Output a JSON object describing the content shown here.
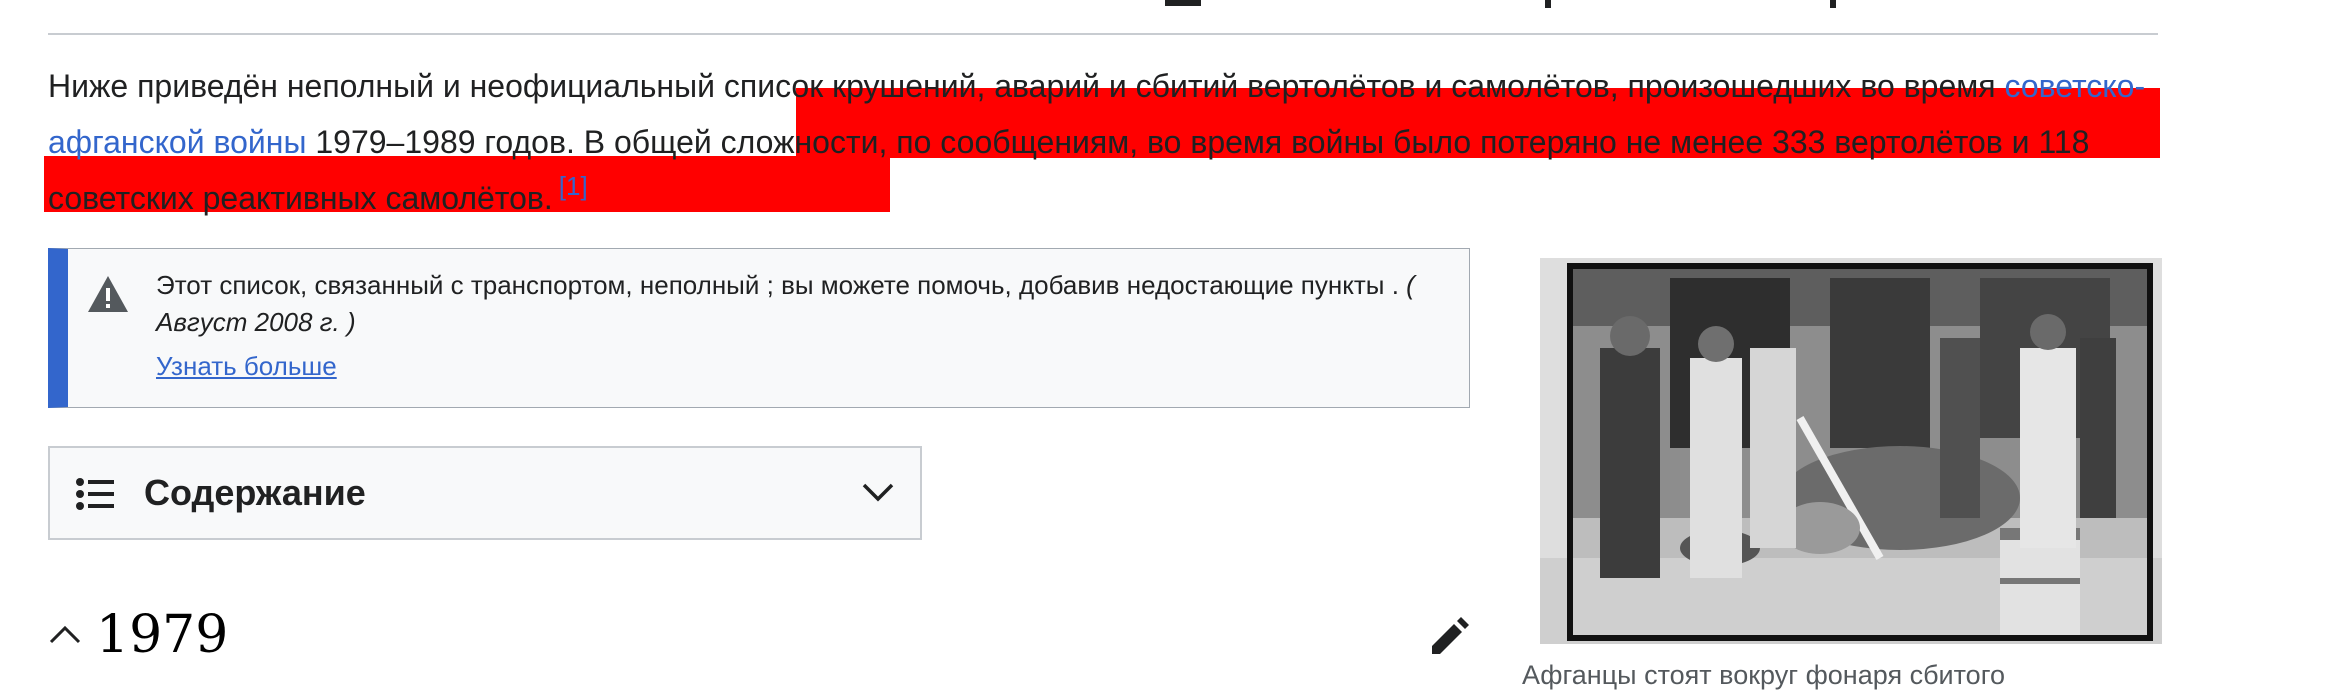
{
  "intro": {
    "text_start": "Ниже приведён неполный и неофициальный список крушений, аварий и сбитий вертолётов и самолётов, произошедших во время ",
    "war_link": "советско-афганской войны",
    "text_mid": " 1979–1989 годов. ",
    "text_highlighted": "В общей сложности, по сообщениям, во время войны было потеряно не менее 333 вертолётов и 118 советских реактивных самолётов.",
    "ref": "[1]",
    "highlight_color": "#ff0000"
  },
  "notice": {
    "icon": "warning-icon",
    "text": "Этот список, связанный с транспортом, неполный ; вы можете помочь, добавив недостающие пункты . ",
    "date": "( Август 2008 г. )",
    "learn_more": "Узнать больше"
  },
  "toc": {
    "icon": "list-icon",
    "title": "Содержание",
    "chevron": "chevron-down-icon"
  },
  "section": {
    "collapse_icon": "chevron-up-icon",
    "heading": "1979",
    "edit_icon": "pencil-icon"
  },
  "figure": {
    "caption": "Афганцы стоят вокруг фонаря сбитого"
  },
  "colors": {
    "link": "#3366cc",
    "notice_border": "#3366cc",
    "text": "#202122"
  }
}
